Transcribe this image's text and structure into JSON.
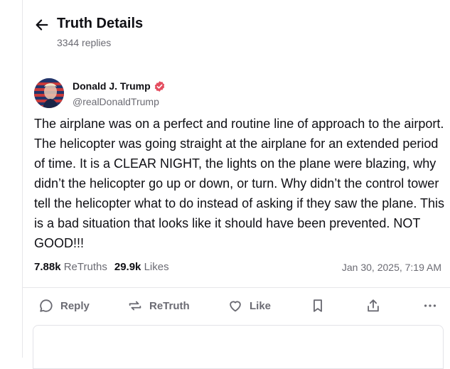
{
  "header": {
    "title": "Truth Details",
    "replies_label": "3344 replies"
  },
  "post": {
    "author_name": "Donald J. Trump",
    "handle": "@realDonaldTrump",
    "text": "The airplane was on a perfect and routine line of approach to the airport. The helicopter was going straight at the airplane for an extended period of time. It is a CLEAR NIGHT, the lights on the plane were blazing, why didn’t the helicopter go up or down, or turn. Why didn’t the control tower tell the helicopter what to do instead of asking if they saw the plane. This is a bad situation that looks like it should have been prevented. NOT GOOD!!!",
    "retruths_count": "7.88k",
    "retruths_label": "ReTruths",
    "likes_count": "29.9k",
    "likes_label": "Likes",
    "timestamp": "Jan 30, 2025, 7:19 AM",
    "verified_color": "#e44d5f"
  },
  "actions": {
    "reply": "Reply",
    "retruth": "ReTruth",
    "like": "Like"
  },
  "icons": [
    "back-arrow-icon",
    "verified-badge-icon",
    "reply-icon",
    "retruth-icon",
    "like-icon",
    "bookmark-icon",
    "share-icon",
    "more-icon"
  ]
}
